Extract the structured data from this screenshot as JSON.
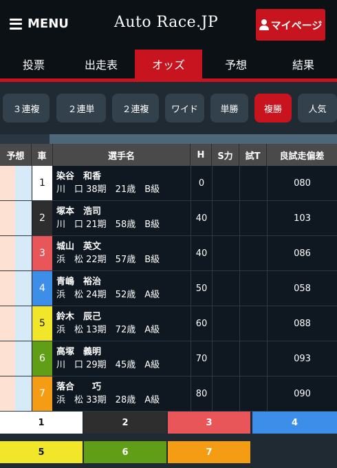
{
  "header": {
    "menu_label": "MENU",
    "logo": "Auto Race.JP",
    "mypage_label": "マイページ"
  },
  "nav": {
    "tabs": [
      {
        "label": "投票",
        "active": false
      },
      {
        "label": "出走表",
        "active": false
      },
      {
        "label": "オッズ",
        "active": true
      },
      {
        "label": "予想",
        "active": false
      },
      {
        "label": "結果",
        "active": false
      }
    ]
  },
  "bet_types": [
    {
      "label": "３連複",
      "active": false
    },
    {
      "label": "２連単",
      "active": false
    },
    {
      "label": "２連複",
      "active": false
    },
    {
      "label": "ワイド",
      "active": false
    },
    {
      "label": "単勝",
      "active": false
    },
    {
      "label": "複勝",
      "active": true
    },
    {
      "label": "人気",
      "active": false
    }
  ],
  "table": {
    "headers": [
      "予想",
      "車",
      "選手名",
      "H",
      "S力",
      "試T",
      "良試走偏差"
    ],
    "rows": [
      {
        "car": "1",
        "name": "染谷　和香",
        "info": "川　口 38期　21歳　B級",
        "h": "0",
        "s": "",
        "t": "",
        "dev": "080"
      },
      {
        "car": "2",
        "name": "塚本　浩司",
        "info": "川　口 21期　58歳　B級",
        "h": "40",
        "s": "",
        "t": "",
        "dev": "103"
      },
      {
        "car": "3",
        "name": "城山　英文",
        "info": "浜　松 22期　57歳　B級",
        "h": "40",
        "s": "",
        "t": "",
        "dev": "086"
      },
      {
        "car": "4",
        "name": "青嶋　裕治",
        "info": "浜　松 24期　52歳　A級",
        "h": "50",
        "s": "",
        "t": "",
        "dev": "058"
      },
      {
        "car": "5",
        "name": "鈴木　辰己",
        "info": "浜　松 13期　72歳　A級",
        "h": "60",
        "s": "",
        "t": "",
        "dev": "088"
      },
      {
        "car": "6",
        "name": "高塚　義明",
        "info": "川　口 29期　45歳　A級",
        "h": "70",
        "s": "",
        "t": "",
        "dev": "093"
      },
      {
        "car": "7",
        "name": "落合　　巧",
        "info": "浜　松 33期　28歳　A級",
        "h": "80",
        "s": "",
        "t": "",
        "dev": "090"
      }
    ]
  },
  "car_colors": {
    "1": {
      "bg": "#ffffff",
      "fg": "#111111"
    },
    "2": {
      "bg": "#2e2e2e",
      "fg": "#ffffff"
    },
    "3": {
      "bg": "#e8565a",
      "fg": "#ffffff"
    },
    "4": {
      "bg": "#3d8ee8",
      "fg": "#ffffff"
    },
    "5": {
      "bg": "#f2e62b",
      "fg": "#111111"
    },
    "6": {
      "bg": "#5f9e16",
      "fg": "#ffffff"
    },
    "7": {
      "bg": "#f59c15",
      "fg": "#ffffff"
    }
  },
  "legend": [
    "1",
    "2",
    "3",
    "4",
    "5",
    "6",
    "7"
  ]
}
